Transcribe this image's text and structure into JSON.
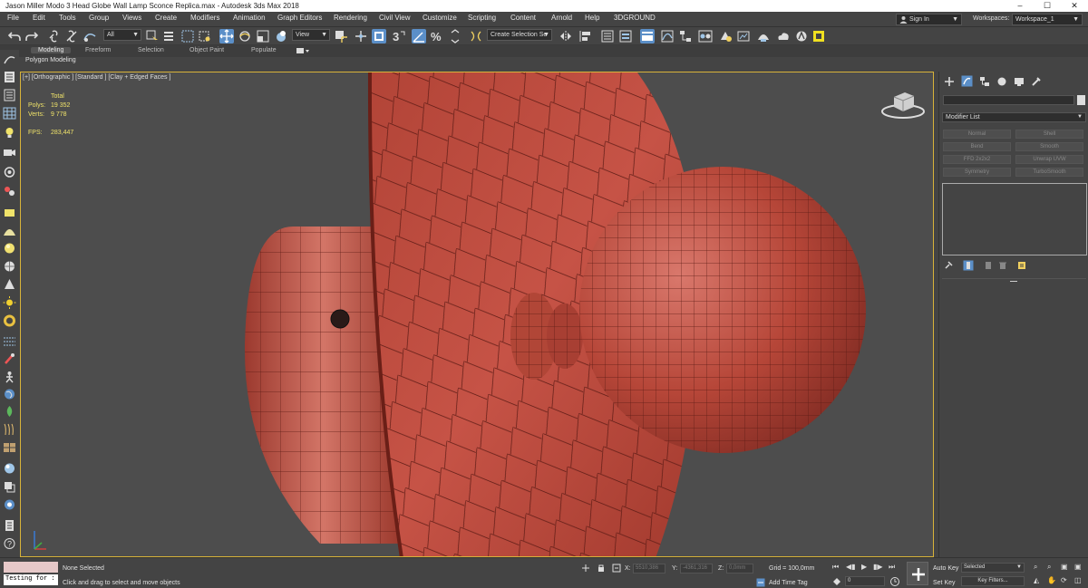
{
  "window": {
    "title": "Jason Miller Modo 3 Head Globe Wall Lamp Sconce Replica.max - Autodesk 3ds Max 2018",
    "controls": [
      "–",
      "☐",
      "✕"
    ]
  },
  "menu": [
    "File",
    "Edit",
    "Tools",
    "Group",
    "Views",
    "Create",
    "Modifiers",
    "Animation",
    "Graph Editors",
    "Rendering",
    "Civil View",
    "Customize",
    "Scripting",
    "Content",
    "Arnold",
    "Help",
    "3DGROUND"
  ],
  "account": {
    "signin": "Sign In",
    "workspaces_label": "Workspaces:",
    "workspace": "Workspace_1"
  },
  "toolbar": {
    "filter": "All",
    "ref_coord": "View",
    "selection_set": "Create Selection Se"
  },
  "ribbon": {
    "tabs": [
      "Modeling",
      "Freeform",
      "Selection",
      "Object Paint",
      "Populate"
    ],
    "sub": "Polygon Modeling"
  },
  "viewport": {
    "label": "[+] [Orthographic ] [Standard ] [Clay + Edged Faces ]",
    "stats": {
      "total_label": "Total",
      "polys_label": "Polys:",
      "polys": "19 352",
      "verts_label": "Verts:",
      "verts": "9 778",
      "fps_label": "FPS:",
      "fps": "283,447"
    }
  },
  "command_panel": {
    "modifier_list": "Modifier List",
    "buttons": [
      "Normal",
      "Shell",
      "Bend",
      "Smooth",
      "FFD 2x2x2",
      "Unwrap UVW",
      "Symmetry",
      "TurboSmooth"
    ]
  },
  "status": {
    "maxscript": "Testing for :",
    "selection": "None Selected",
    "prompt": "Click and drag to select and move objects",
    "x_label": "X:",
    "x": "5510,386",
    "y_label": "Y:",
    "y": "-4361,316",
    "z_label": "Z:",
    "z": "0,0mm",
    "grid": "Grid = 100,0mm",
    "add_time_tag": "Add Time Tag",
    "frame": "0",
    "auto_key": "Auto Key",
    "set_key": "Set Key",
    "key_mode": "Selected",
    "key_filters": "Key Filters..."
  },
  "colors": {
    "ui_bg": "#444444",
    "viewport_bg": "#4d4d4d",
    "viewport_border": "#d8b33a",
    "clay": "#c4483b",
    "stats_text": "#f0e36a",
    "accent": "#5b8fc8"
  }
}
